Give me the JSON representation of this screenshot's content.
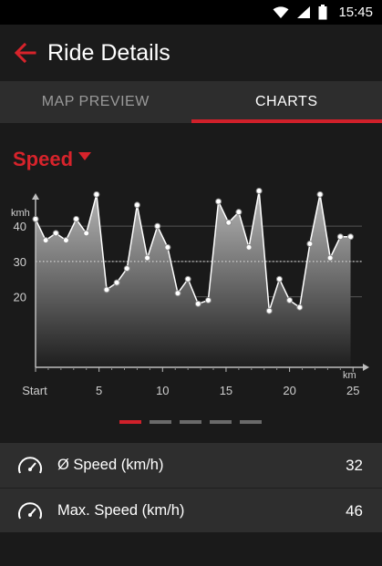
{
  "status_bar": {
    "time": "15:45"
  },
  "header": {
    "title": "Ride Details"
  },
  "tabs": [
    {
      "label": "MAP PREVIEW",
      "active": false
    },
    {
      "label": "CHARTS",
      "active": true
    }
  ],
  "metric_selector": {
    "label": "Speed"
  },
  "colors": {
    "accent": "#d0202a",
    "background": "#1a1a1a",
    "panel": "#2e2e2e"
  },
  "chart_data": {
    "type": "area",
    "xlabel": "km",
    "ylabel": "kmh",
    "x_ticks": [
      "Start",
      "5",
      "10",
      "15",
      "20",
      "25"
    ],
    "y_ticks": [
      "20",
      "30",
      "40"
    ],
    "xlim": [
      0,
      25.7
    ],
    "ylim": [
      0,
      46.5
    ],
    "average_line": 30,
    "grid": true,
    "series": [
      {
        "x": [
          0,
          0.8,
          1.6,
          2.4,
          3.2,
          4.0,
          4.8,
          5.6,
          6.4,
          7.2,
          8.0,
          8.8,
          9.6,
          10.4,
          11.2,
          12.0,
          12.8,
          13.6,
          14.4,
          15.2,
          16.0,
          16.8,
          17.6,
          18.4,
          19.2,
          20.0,
          20.8,
          21.6,
          22.4,
          23.2,
          24.0,
          24.8
        ],
        "values": [
          42,
          36,
          38,
          36,
          42,
          38,
          49,
          22,
          24,
          28,
          46,
          31,
          40,
          34,
          21,
          25,
          18,
          19,
          47,
          41,
          44,
          34,
          50,
          16,
          25,
          19,
          17,
          35,
          49,
          31,
          37,
          37
        ]
      }
    ]
  },
  "pager": {
    "count": 5,
    "active_index": 0
  },
  "stats": [
    {
      "icon": "gauge-icon",
      "label": "Ø Speed (km/h)",
      "value": "32"
    },
    {
      "icon": "gauge-icon",
      "label": "Max. Speed (km/h)",
      "value": "46"
    }
  ]
}
